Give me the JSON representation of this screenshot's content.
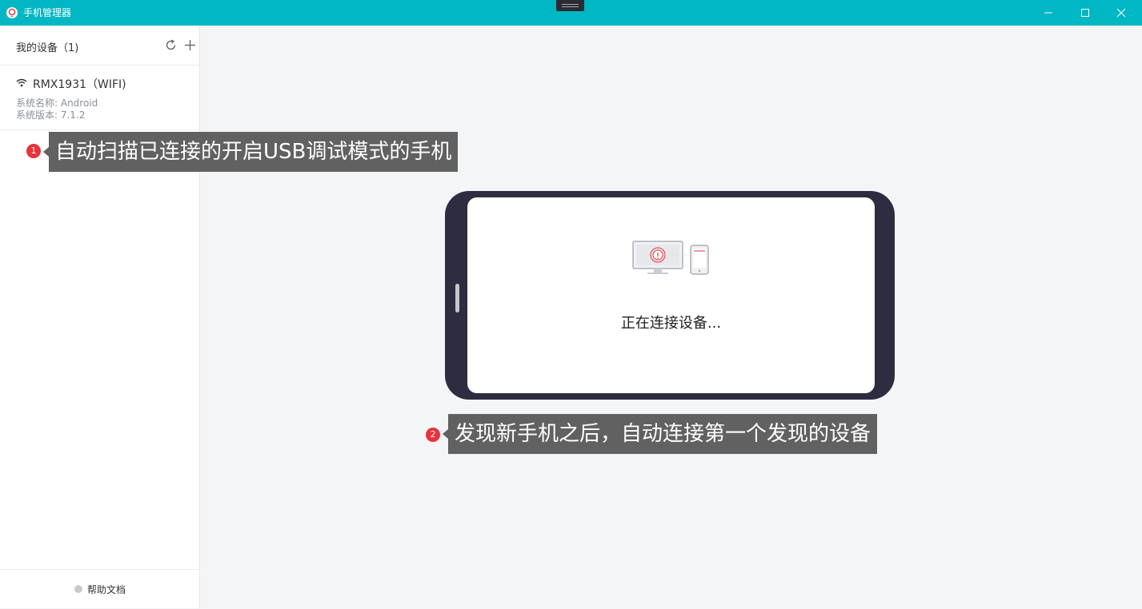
{
  "window": {
    "title": "手机管理器",
    "accent_color": "#00b7c3"
  },
  "sidebar": {
    "title": "我的设备（1)",
    "refresh_icon": "refresh-icon",
    "add_icon": "plus-icon",
    "devices": [
      {
        "name": "RMX1931（WIFI)",
        "connection_icon": "wifi-icon",
        "system_name": "系统名称: Android",
        "system_version": "系统版本: 7.1.2"
      }
    ],
    "footer": {
      "help_label": "帮助文档"
    }
  },
  "annotations": [
    {
      "badge": "1",
      "text": "自动扫描已连接的开启USB调试模式的手机"
    },
    {
      "badge": "2",
      "text": "发现新手机之后，自动连接第一个发现的设备"
    }
  ],
  "main": {
    "status_text": "正在连接设备...",
    "illustration_icon": "computer-phone-connect-icon"
  },
  "colors": {
    "badge": "#e8323c",
    "callout": "#616161",
    "phone_frame": "#2e2c40"
  }
}
